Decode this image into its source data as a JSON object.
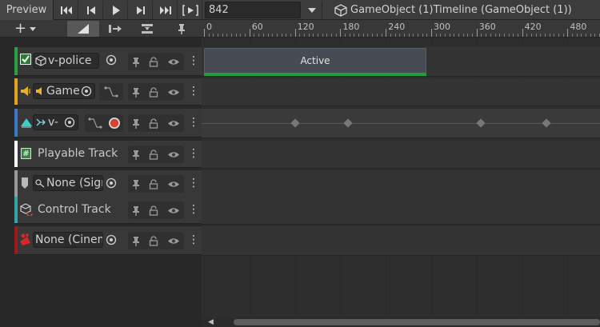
{
  "toolbar": {
    "preview_label": "Preview",
    "frame_value": "842",
    "timeline_title": "GameObject (1)Timeline (GameObject (1))",
    "icons": [
      "first-frame-icon",
      "previous-frame-icon",
      "play-icon",
      "next-frame-icon",
      "last-frame-icon",
      "play-range-icon",
      "dropdown-icon",
      "gameobject-icon"
    ]
  },
  "toolbar2": {
    "add_label": "+",
    "icons": [
      "add-icon",
      "ease-mode-icon",
      "ripple-mode-icon",
      "replace-mode-icon",
      "pin-icon"
    ]
  },
  "ruler": {
    "labels": [
      "0",
      "60",
      "120",
      "180",
      "240",
      "300",
      "360",
      "420",
      "480"
    ]
  },
  "tracks": [
    {
      "label": "v-police",
      "color": "#27a33f",
      "type": "activation"
    },
    {
      "label": "Game",
      "color": "#e2a41c",
      "type": "audio"
    },
    {
      "label": "v-",
      "color": "#3c78c8",
      "type": "animation"
    },
    {
      "label": "Playable Track",
      "color": "#ffffff",
      "type": "playable"
    },
    {
      "label": "None (Sign",
      "color": "#9a9a9a",
      "type": "signal"
    },
    {
      "label": "Control Track",
      "color": "#36a4a2",
      "type": "control"
    },
    {
      "label": "None (Cinem",
      "color": "#9c1a1a",
      "type": "cinemachine"
    }
  ],
  "clips": [
    {
      "label": "Active",
      "track": 0,
      "start": 0,
      "end": 296,
      "color": "#239d3b"
    }
  ],
  "keyframes": {
    "track": 2,
    "frames": [
      120,
      190,
      366,
      452
    ]
  }
}
